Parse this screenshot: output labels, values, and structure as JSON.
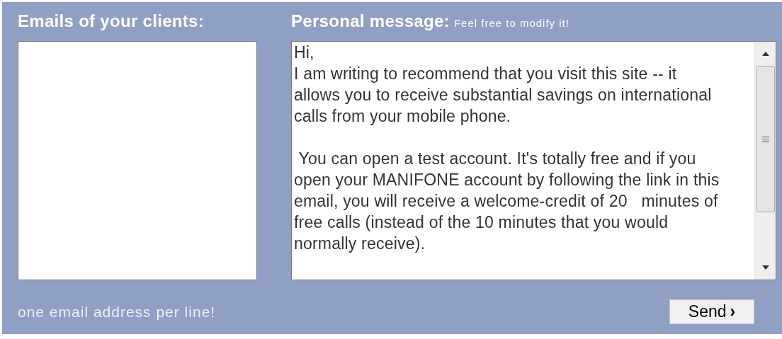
{
  "emails": {
    "heading": "Emails of your clients:",
    "hint": "one email address per line!"
  },
  "message": {
    "heading": "Personal message:",
    "note": "Feel free to modify it!",
    "paragraphs": [
      [
        "Hi,",
        "I am writing to recommend that you visit this site -- it",
        "allows you to receive substantial savings on international",
        "calls from your mobile phone."
      ],
      [
        " You can open a test account. It's totally free and if you",
        "open your MANIFONE account by following the link in this",
        "email, you will receive a welcome-credit of 20   minutes of",
        "free calls (instead of the 10 minutes that you would",
        "normally receive)."
      ]
    ]
  },
  "send_button": {
    "label": "Send",
    "arrow": "›"
  }
}
